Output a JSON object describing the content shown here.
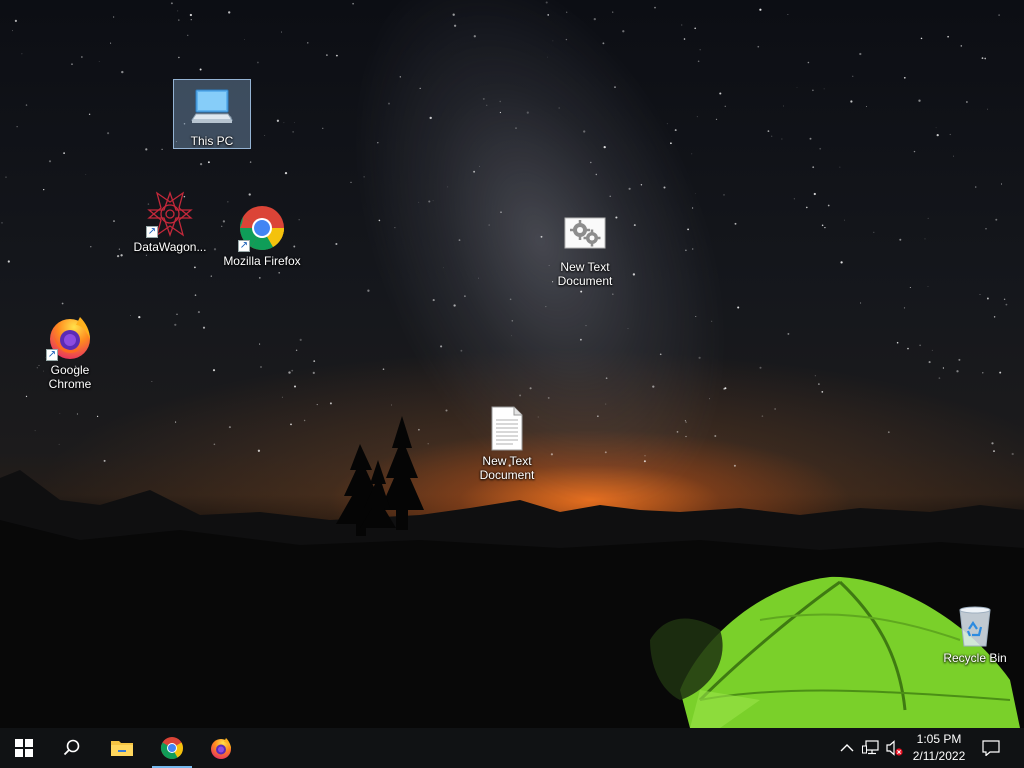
{
  "desktop": {
    "icons": {
      "this_pc": "This PC",
      "datawagon": "DataWagon...",
      "mozilla_firefox": "Mozilla Firefox",
      "new_text_doc_gear": "New Text Document",
      "google_chrome": "Google Chrome",
      "new_text_doc": "New Text Document",
      "recycle_bin": "Recycle Bin"
    },
    "selected_icon": "This PC"
  },
  "taskbar": {
    "pinned": [
      {
        "name": "start",
        "icon": "windows-logo"
      },
      {
        "name": "search",
        "icon": "search-icon"
      },
      {
        "name": "file-explorer",
        "icon": "folder-icon"
      },
      {
        "name": "chrome",
        "icon": "chrome-icon",
        "running": true
      },
      {
        "name": "firefox",
        "icon": "firefox-icon"
      }
    ],
    "tray": {
      "time": "1:05 PM",
      "date": "2/11/2022",
      "icons": [
        "chevron-up-icon",
        "network-icon",
        "volume-muted-icon",
        "notification-icon"
      ]
    },
    "accent_color": "#76b9ed"
  }
}
